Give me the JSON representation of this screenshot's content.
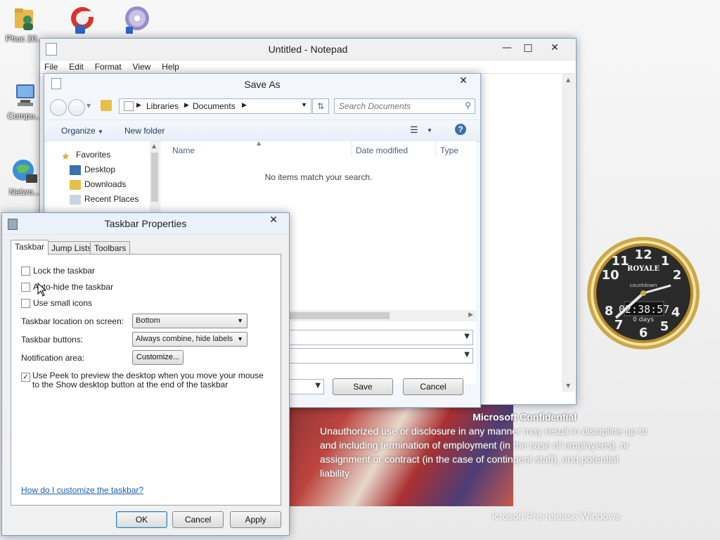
{
  "desktop": {
    "icons": [
      {
        "label": "Phuc 20..."
      },
      {
        "label": ""
      },
      {
        "label": ""
      },
      {
        "label": "Compu..."
      },
      {
        "label": "Netwo..."
      }
    ],
    "confidential_title": "Microsoft Confidential",
    "confidential_lines": [
      "Unauthorized use or disclosure in any manner may result in discipline up to",
      "and including termination of employment (in the case of employees), or",
      "assignment or contract (in the case of contingent staff), and potential",
      "liability."
    ],
    "prerelease": "icrosoft Pre-release Windows"
  },
  "notepad": {
    "title": "Untitled - Notepad",
    "menu": [
      "File",
      "Edit",
      "Format",
      "View",
      "Help"
    ]
  },
  "saveas": {
    "title": "Save As",
    "breadcrumbs": [
      "Libraries",
      "Documents"
    ],
    "search_placeholder": "Search Documents",
    "organize": "Organize",
    "new_folder": "New folder",
    "nav": [
      "Favorites",
      "Desktop",
      "Downloads",
      "Recent Places"
    ],
    "columns": [
      "Name",
      "Date modified",
      "Type"
    ],
    "empty_message": "No items match your search.",
    "save_button": "Save",
    "cancel_button": "Cancel"
  },
  "taskbar_props": {
    "title": "Taskbar Properties",
    "tabs": [
      "Taskbar",
      "Jump Lists",
      "Toolbars"
    ],
    "options": [
      {
        "label": "Lock the taskbar",
        "checked": false
      },
      {
        "label": "Auto-hide the taskbar",
        "checked": false
      },
      {
        "label": "Use small icons",
        "checked": false
      }
    ],
    "location_label": "Taskbar location on screen:",
    "location_value": "Bottom",
    "buttons_label": "Taskbar buttons:",
    "buttons_value": "Always combine, hide labels",
    "notification_label": "Notification area:",
    "customize_button": "Customize...",
    "peek_label": "Use Peek to preview the desktop when you move your mouse to the Show desktop button at the end of the taskbar",
    "peek_checked": true,
    "help_link": "How do I customize the taskbar?",
    "ok": "OK",
    "cancel": "Cancel",
    "apply": "Apply"
  },
  "clock": {
    "brand": "ROYALE",
    "subtitle": "countdown",
    "time": "02:38:57",
    "days": "0 days"
  },
  "colors": {
    "accent": "#1a5fb4",
    "window_border": "#7d9fc7",
    "clock_gold": "#c9a94a"
  }
}
